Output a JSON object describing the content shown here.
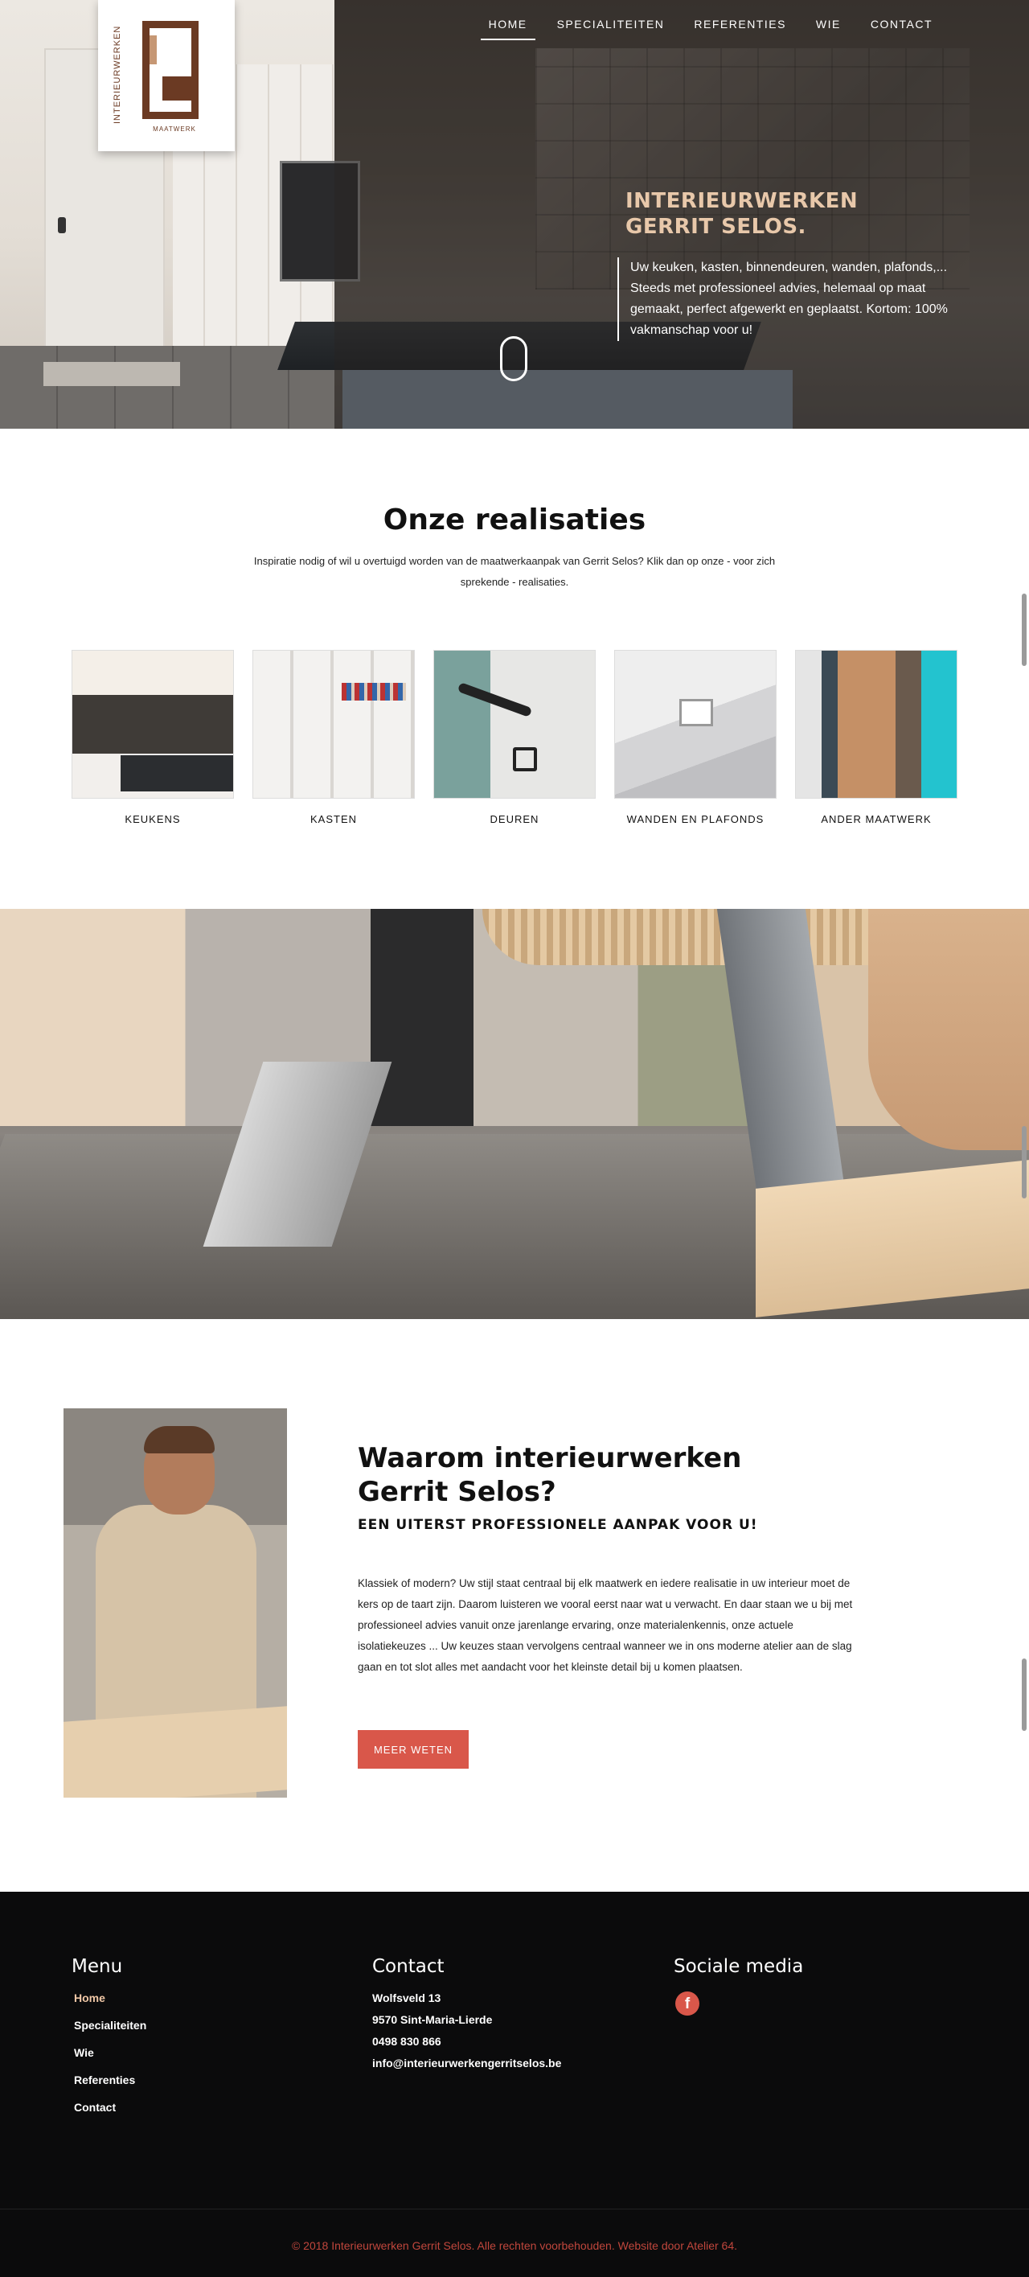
{
  "nav": {
    "items": [
      "HOME",
      "SPECIALITEITEN",
      "REFERENTIES",
      "WIE",
      "CONTACT"
    ],
    "active": "HOME"
  },
  "logo": {
    "vertical_text": "INTERIEURWERKEN",
    "sub_text": "MAATWERK",
    "colors": {
      "dark": "#6b3a23",
      "light": "#c69774"
    }
  },
  "hero": {
    "title": "INTERIEURWERKEN GERRIT SELOS.",
    "text": "Uw keuken, kasten, binnendeuren, wanden, plafonds,... Steeds met professioneel advies, helemaal op maat gemaakt, perfect afgewerkt en geplaatst. Kortom: 100% vakmanschap voor u!",
    "title_color": "#e8c8aa"
  },
  "realisaties": {
    "title": "Onze realisaties",
    "intro": "Inspiratie nodig of wil u overtuigd worden van de maatwerkaanpak van Gerrit Selos? Klik dan op onze - voor zich sprekende - realisaties.",
    "items": [
      {
        "label": "KEUKENS"
      },
      {
        "label": "KASTEN"
      },
      {
        "label": "DEUREN"
      },
      {
        "label": "WANDEN EN PLAFONDS"
      },
      {
        "label": "ANDER MAATWERK"
      }
    ]
  },
  "waarom": {
    "title": "Waarom interieurwerken Gerrit Selos?",
    "subtitle": "EEN UITERST PROFESSIONELE AANPAK VOOR U!",
    "body": "Klassiek of modern? Uw stijl staat centraal bij elk maatwerk en iedere realisatie in uw interieur moet de kers op de taart zijn. Daarom luisteren we vooral eerst naar wat u verwacht. En daar staan we u bij met professioneel advies vanuit onze jarenlange ervaring, onze materialenkennis, onze actuele isolatiekeuzes ... Uw keuzes staan vervolgens centraal wanneer we in ons moderne atelier aan de slag gaan en tot slot alles met aandacht voor het kleinste detail bij u komen plaatsen.",
    "button": "MEER WETEN",
    "accent": "#d9574a"
  },
  "footer": {
    "menu_title": "Menu",
    "menu": [
      "Home",
      "Specialiteiten",
      "Wie",
      "Referenties",
      "Contact"
    ],
    "menu_active": "Home",
    "contact_title": "Contact",
    "contact": [
      "Wolfsveld 13",
      "9570 Sint-Maria-Lierde",
      "0498 830 866",
      "info@interieurwerkengerritselos.be"
    ],
    "social_title": "Sociale media",
    "social_icon": "facebook-icon",
    "social_glyph": "f",
    "copyright": "© 2018 Interieurwerken Gerrit Selos. Alle rechten voorbehouden. Website door Atelier 64."
  }
}
